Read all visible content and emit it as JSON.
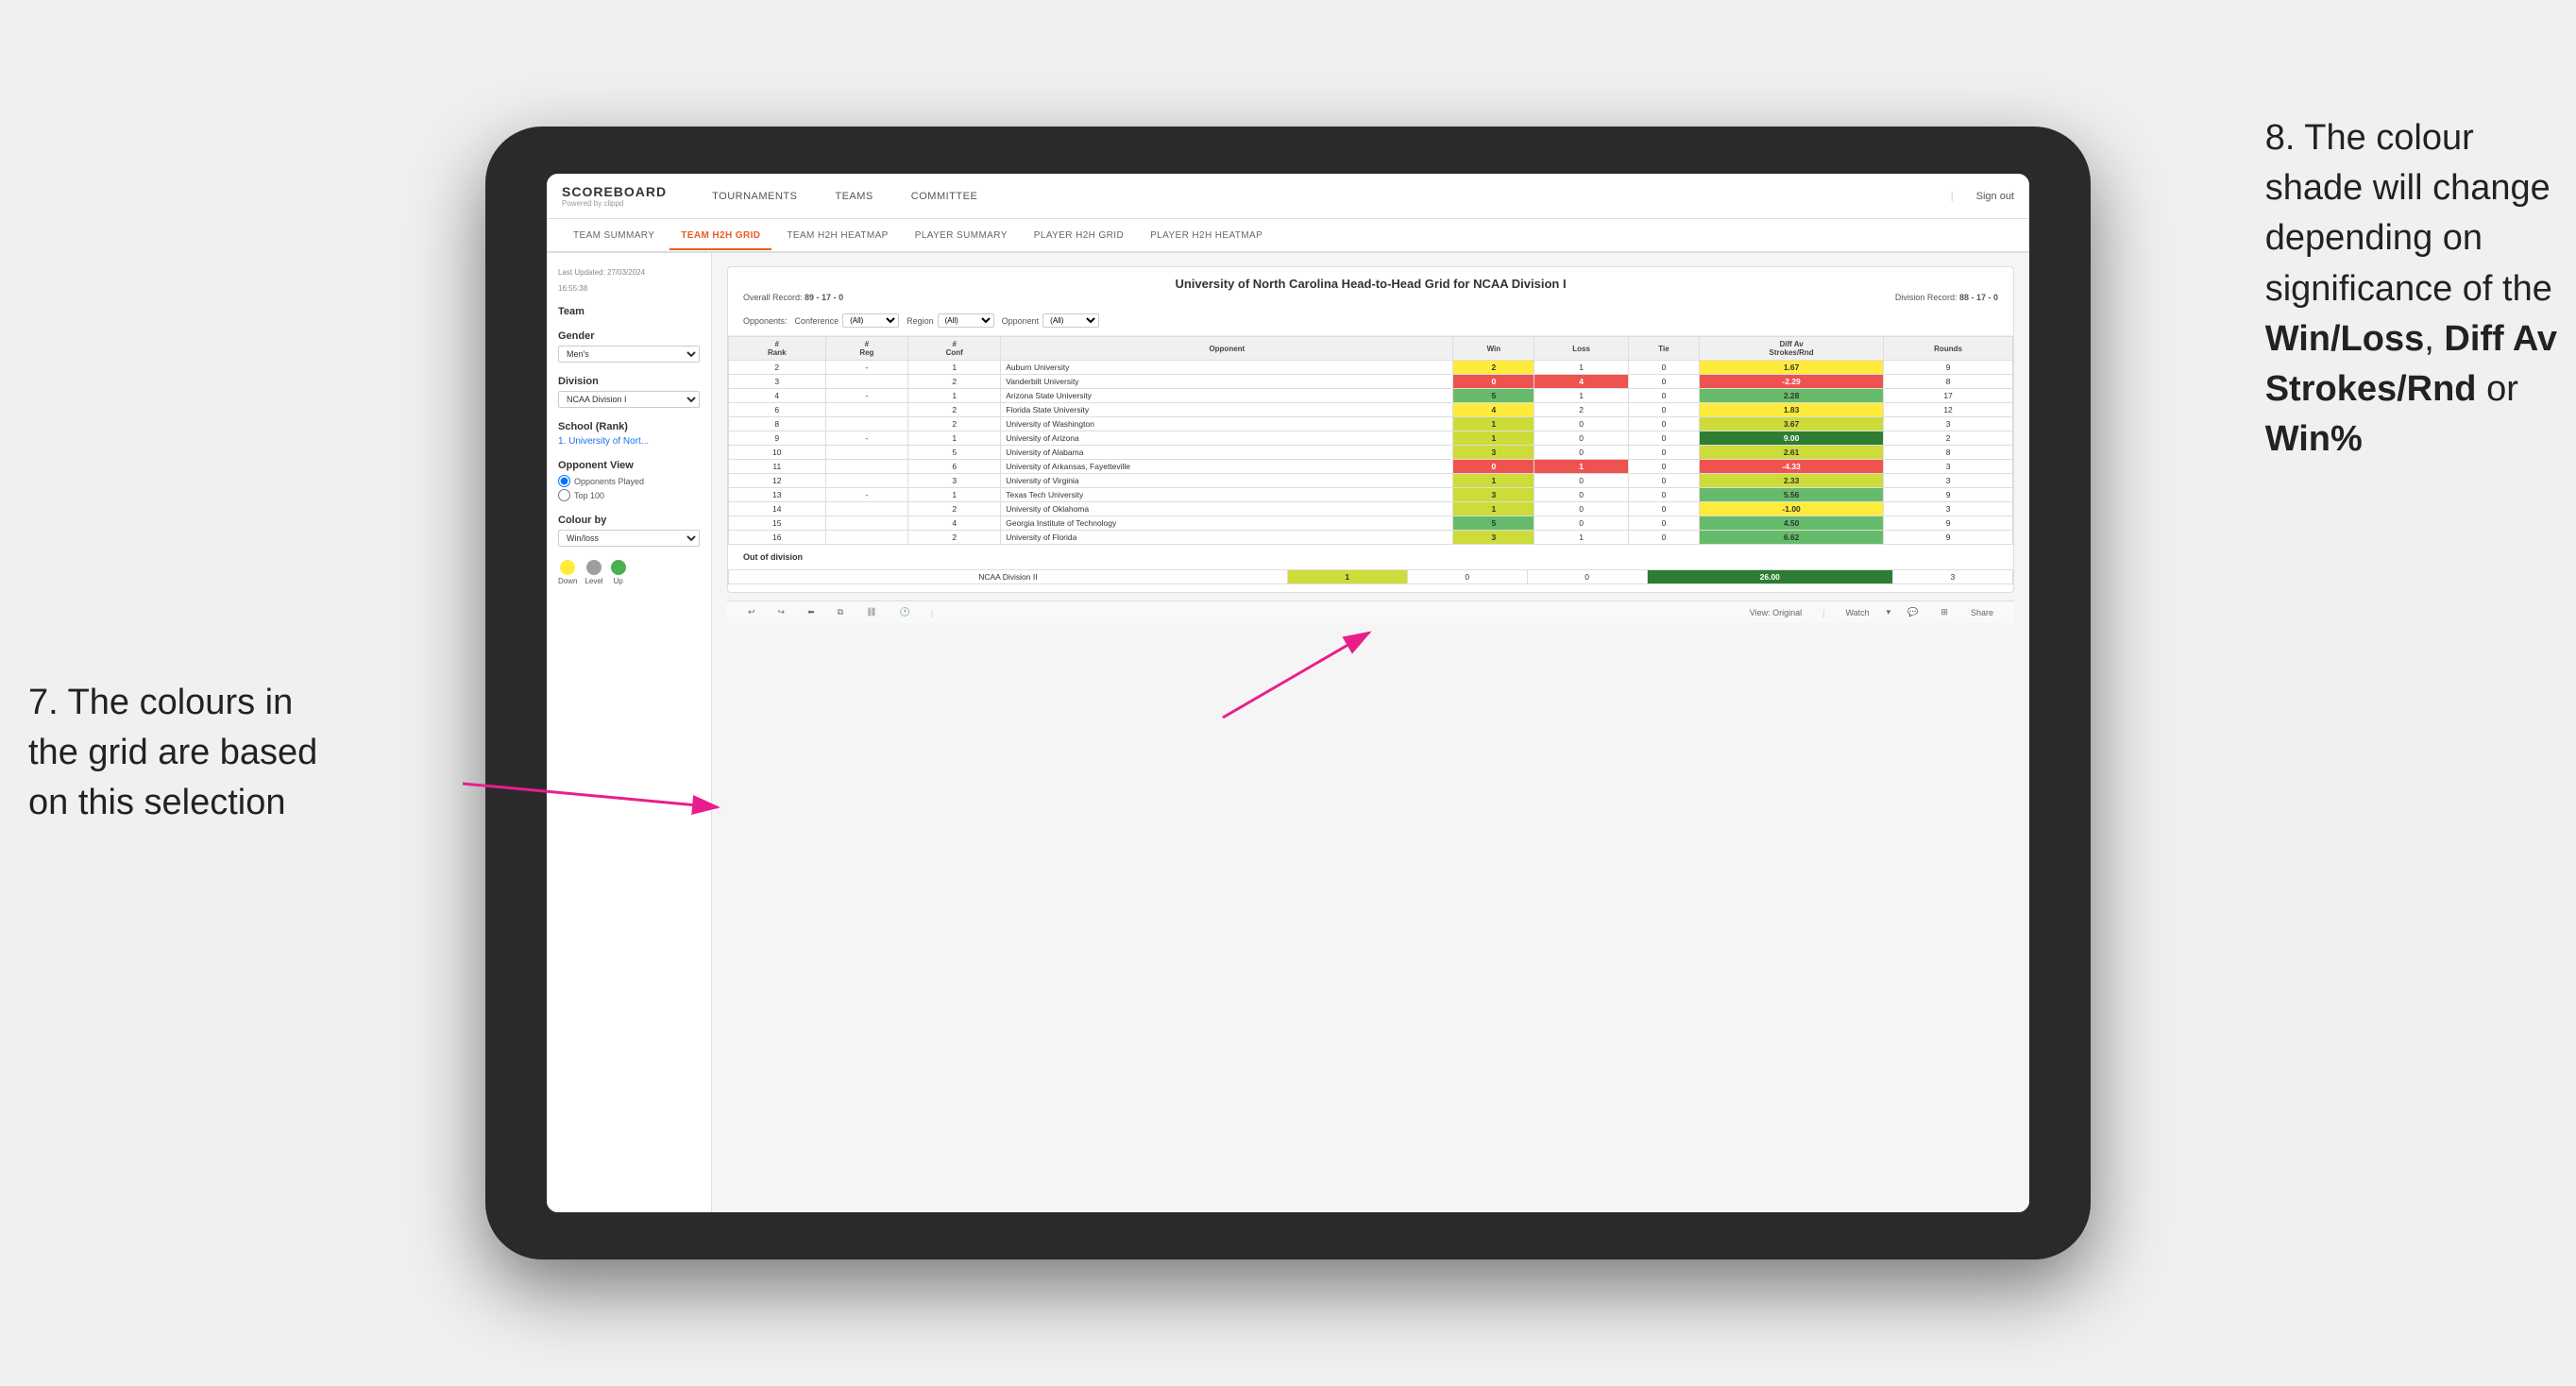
{
  "page": {
    "background": "#f0f0f0"
  },
  "annotation_left": {
    "line1": "7. The colours in",
    "line2": "the grid are based",
    "line3": "on this selection"
  },
  "annotation_right": {
    "line1": "8. The colour",
    "line2": "shade will change",
    "line3": "depending on",
    "line4": "significance of the",
    "bold1": "Win/Loss",
    "comma": ", ",
    "bold2": "Diff Av",
    "bold3": "Strokes/Rnd",
    "or": " or",
    "bold4": "Win%"
  },
  "header": {
    "logo": "SCOREBOARD",
    "logo_sub": "Powered by clippd",
    "nav": [
      "TOURNAMENTS",
      "TEAMS",
      "COMMITTEE"
    ],
    "sign_out": "Sign out"
  },
  "sub_nav": {
    "items": [
      "TEAM SUMMARY",
      "TEAM H2H GRID",
      "TEAM H2H HEATMAP",
      "PLAYER SUMMARY",
      "PLAYER H2H GRID",
      "PLAYER H2H HEATMAP"
    ],
    "active": "TEAM H2H GRID"
  },
  "sidebar": {
    "last_updated_label": "Last Updated: 27/03/2024",
    "last_updated_time": "16:55:38",
    "team_section": "Team",
    "gender_label": "Gender",
    "gender_value": "Men's",
    "division_label": "Division",
    "division_value": "NCAA Division I",
    "school_label": "School (Rank)",
    "school_value": "1. University of Nort...",
    "opponent_view_label": "Opponent View",
    "radio1": "Opponents Played",
    "radio2": "Top 100",
    "colour_by_label": "Colour by",
    "colour_by_value": "Win/loss",
    "legend": {
      "down_label": "Down",
      "level_label": "Level",
      "up_label": "Up",
      "down_color": "#ffeb3b",
      "level_color": "#aaa",
      "up_color": "#4caf50"
    }
  },
  "report": {
    "title": "University of North Carolina Head-to-Head Grid for NCAA Division I",
    "overall_record_label": "Overall Record:",
    "overall_record": "89 - 17 - 0",
    "division_record_label": "Division Record:",
    "division_record": "88 - 17 - 0",
    "filter_conference_label": "Conference",
    "filter_opponents_label": "Opponents:",
    "filter_all": "(All)",
    "filter_region_label": "Region",
    "filter_opponent_label": "Opponent",
    "columns": [
      "#\nRank",
      "#\nReg",
      "#\nConf",
      "Opponent",
      "Win",
      "Loss",
      "Tie",
      "Diff Av\nStrokes/Rnd",
      "Rounds"
    ],
    "rows": [
      {
        "rank": "2",
        "reg": "-",
        "conf": "1",
        "opponent": "Auburn University",
        "win": "2",
        "loss": "1",
        "tie": "0",
        "diff": "1.67",
        "rounds": "9",
        "win_color": "yellow",
        "diff_color": "yellow"
      },
      {
        "rank": "3",
        "reg": "",
        "conf": "2",
        "opponent": "Vanderbilt University",
        "win": "0",
        "loss": "4",
        "tie": "0",
        "diff": "-2.29",
        "rounds": "8",
        "win_color": "red",
        "diff_color": "red"
      },
      {
        "rank": "4",
        "reg": "-",
        "conf": "1",
        "opponent": "Arizona State University",
        "win": "5",
        "loss": "1",
        "tie": "0",
        "diff": "2.28",
        "rounds": "17",
        "win_color": "green_med",
        "diff_color": "green_med"
      },
      {
        "rank": "6",
        "reg": "",
        "conf": "2",
        "opponent": "Florida State University",
        "win": "4",
        "loss": "2",
        "tie": "0",
        "diff": "1.83",
        "rounds": "12",
        "win_color": "yellow",
        "diff_color": "yellow"
      },
      {
        "rank": "8",
        "reg": "",
        "conf": "2",
        "opponent": "University of Washington",
        "win": "1",
        "loss": "0",
        "tie": "0",
        "diff": "3.67",
        "rounds": "3",
        "win_color": "green_light",
        "diff_color": "green_light"
      },
      {
        "rank": "9",
        "reg": "-",
        "conf": "1",
        "opponent": "University of Arizona",
        "win": "1",
        "loss": "0",
        "tie": "0",
        "diff": "9.00",
        "rounds": "2",
        "win_color": "green_light",
        "diff_color": "green_dark"
      },
      {
        "rank": "10",
        "reg": "",
        "conf": "5",
        "opponent": "University of Alabama",
        "win": "3",
        "loss": "0",
        "tie": "0",
        "diff": "2.61",
        "rounds": "8",
        "win_color": "green_light",
        "diff_color": "green_light"
      },
      {
        "rank": "11",
        "reg": "",
        "conf": "6",
        "opponent": "University of Arkansas, Fayetteville",
        "win": "0",
        "loss": "1",
        "tie": "0",
        "diff": "-4.33",
        "rounds": "3",
        "win_color": "red",
        "diff_color": "red"
      },
      {
        "rank": "12",
        "reg": "",
        "conf": "3",
        "opponent": "University of Virginia",
        "win": "1",
        "loss": "0",
        "tie": "0",
        "diff": "2.33",
        "rounds": "3",
        "win_color": "green_light",
        "diff_color": "green_light"
      },
      {
        "rank": "13",
        "reg": "-",
        "conf": "1",
        "opponent": "Texas Tech University",
        "win": "3",
        "loss": "0",
        "tie": "0",
        "diff": "5.56",
        "rounds": "9",
        "win_color": "green_light",
        "diff_color": "green_med"
      },
      {
        "rank": "14",
        "reg": "",
        "conf": "2",
        "opponent": "University of Oklahoma",
        "win": "1",
        "loss": "0",
        "tie": "0",
        "diff": "-1.00",
        "rounds": "3",
        "win_color": "green_light",
        "diff_color": "yellow"
      },
      {
        "rank": "15",
        "reg": "",
        "conf": "4",
        "opponent": "Georgia Institute of Technology",
        "win": "5",
        "loss": "0",
        "tie": "0",
        "diff": "4.50",
        "rounds": "9",
        "win_color": "green_med",
        "diff_color": "green_med"
      },
      {
        "rank": "16",
        "reg": "",
        "conf": "2",
        "opponent": "University of Florida",
        "win": "3",
        "loss": "1",
        "tie": "0",
        "diff": "6.62",
        "rounds": "9",
        "win_color": "green_light",
        "diff_color": "green_med"
      }
    ],
    "out_of_division_label": "Out of division",
    "out_rows": [
      {
        "division": "NCAA Division II",
        "win": "1",
        "loss": "0",
        "tie": "0",
        "diff": "26.00",
        "rounds": "3",
        "win_color": "green_light",
        "diff_color": "green_dark"
      }
    ]
  },
  "toolbar": {
    "watch_label": "Watch",
    "share_label": "Share",
    "view_label": "View: Original"
  },
  "colors": {
    "green_dark": "#2e7d32",
    "green_med": "#66bb6a",
    "green_light": "#cddc39",
    "yellow": "#ffeb3b",
    "orange": "#ff9800",
    "red": "#ef5350",
    "accent": "#e85d26"
  }
}
